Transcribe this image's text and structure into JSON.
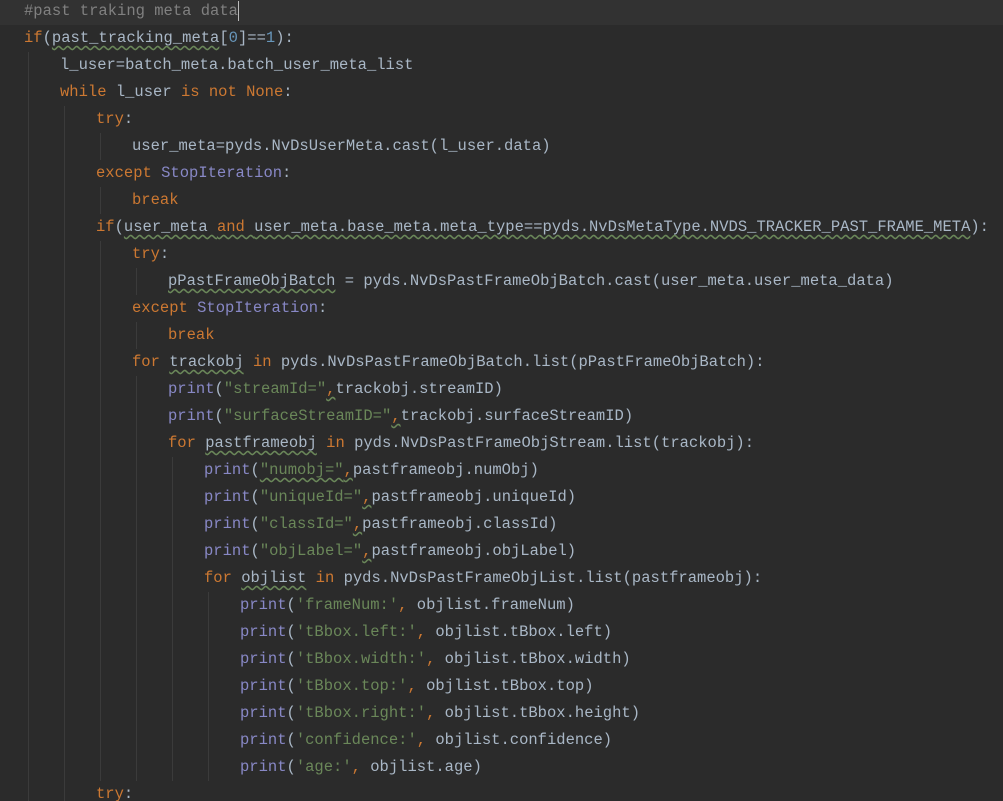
{
  "editor": {
    "theme": {
      "background": "#2b2b2b",
      "current_line": "#323232",
      "keyword": "#cc7832",
      "identifier": "#a9b7c6",
      "number": "#6897bb",
      "string": "#6a8759",
      "comment": "#808080",
      "builtin": "#8888c6"
    },
    "lines": [
      {
        "indent": 0,
        "current": true,
        "tokens": [
          {
            "t": "#past traking meta data",
            "c": "cm"
          }
        ]
      },
      {
        "indent": 0,
        "tokens": [
          {
            "t": "if",
            "c": "kw"
          },
          {
            "t": "(",
            "c": "op"
          },
          {
            "t": "past_tracking_meta",
            "c": "id",
            "sq": true
          },
          {
            "t": "[",
            "c": "op"
          },
          {
            "t": "0",
            "c": "num"
          },
          {
            "t": "]==",
            "c": "op"
          },
          {
            "t": "1",
            "c": "num"
          },
          {
            "t": "):",
            "c": "op"
          }
        ]
      },
      {
        "indent": 1,
        "tokens": [
          {
            "t": "l_user=batch_meta.batch_user_meta_list",
            "c": "id"
          }
        ]
      },
      {
        "indent": 1,
        "tokens": [
          {
            "t": "while ",
            "c": "kw"
          },
          {
            "t": "l_user ",
            "c": "id"
          },
          {
            "t": "is not ",
            "c": "kw"
          },
          {
            "t": "None",
            "c": "kw"
          },
          {
            "t": ":",
            "c": "op"
          }
        ]
      },
      {
        "indent": 2,
        "tokens": [
          {
            "t": "try",
            "c": "kw"
          },
          {
            "t": ":",
            "c": "op"
          }
        ]
      },
      {
        "indent": 3,
        "tokens": [
          {
            "t": "user_meta=pyds.NvDsUserMeta.cast(l_user.data)",
            "c": "id"
          }
        ]
      },
      {
        "indent": 2,
        "tokens": [
          {
            "t": "except ",
            "c": "kw"
          },
          {
            "t": "StopIteration",
            "c": "cls"
          },
          {
            "t": ":",
            "c": "op"
          }
        ]
      },
      {
        "indent": 3,
        "tokens": [
          {
            "t": "break",
            "c": "kw"
          }
        ]
      },
      {
        "indent": 2,
        "tokens": [
          {
            "t": "if",
            "c": "kw"
          },
          {
            "t": "(",
            "c": "op"
          },
          {
            "t": "user_meta ",
            "c": "id",
            "sq": true
          },
          {
            "t": "and ",
            "c": "kw",
            "sq": true
          },
          {
            "t": "user_meta.base_meta.meta_type==pyds.NvDsMetaType.NVDS_TRACKER_PAST_FRAME_META",
            "c": "id",
            "sq": true
          },
          {
            "t": "):",
            "c": "op"
          }
        ]
      },
      {
        "indent": 3,
        "tokens": [
          {
            "t": "try",
            "c": "kw"
          },
          {
            "t": ":",
            "c": "op"
          }
        ]
      },
      {
        "indent": 4,
        "tokens": [
          {
            "t": "pPastFrameObjBatch",
            "c": "id",
            "sq": true
          },
          {
            "t": " = pyds.NvDsPastFrameObjBatch.cast(user_meta.user_meta_data)",
            "c": "id"
          }
        ]
      },
      {
        "indent": 3,
        "tokens": [
          {
            "t": "except ",
            "c": "kw"
          },
          {
            "t": "StopIteration",
            "c": "cls"
          },
          {
            "t": ":",
            "c": "op"
          }
        ]
      },
      {
        "indent": 4,
        "tokens": [
          {
            "t": "break",
            "c": "kw"
          }
        ]
      },
      {
        "indent": 3,
        "tokens": [
          {
            "t": "for ",
            "c": "kw"
          },
          {
            "t": "trackobj",
            "c": "id",
            "sq": true
          },
          {
            "t": " in ",
            "c": "kw"
          },
          {
            "t": "pyds.NvDsPastFrameObjBatch.list(pPastFrameObjBatch):",
            "c": "id"
          }
        ]
      },
      {
        "indent": 4,
        "tokens": [
          {
            "t": "print",
            "c": "cls"
          },
          {
            "t": "(",
            "c": "op"
          },
          {
            "t": "\"streamId=\"",
            "c": "str"
          },
          {
            "t": ",",
            "c": "kw",
            "sq": true
          },
          {
            "t": "trackobj.streamID)",
            "c": "id"
          }
        ]
      },
      {
        "indent": 4,
        "tokens": [
          {
            "t": "print",
            "c": "cls"
          },
          {
            "t": "(",
            "c": "op"
          },
          {
            "t": "\"surfaceStreamID=\"",
            "c": "str"
          },
          {
            "t": ",",
            "c": "kw",
            "sq": true
          },
          {
            "t": "trackobj.surfaceStreamID)",
            "c": "id"
          }
        ]
      },
      {
        "indent": 4,
        "tokens": [
          {
            "t": "for ",
            "c": "kw"
          },
          {
            "t": "pastframeobj",
            "c": "id",
            "sq": true
          },
          {
            "t": " in ",
            "c": "kw"
          },
          {
            "t": "pyds.NvDsPastFrameObjStream.list(trackobj):",
            "c": "id"
          }
        ]
      },
      {
        "indent": 5,
        "tokens": [
          {
            "t": "print",
            "c": "cls"
          },
          {
            "t": "(",
            "c": "op"
          },
          {
            "t": "\"numobj=\"",
            "c": "str",
            "sq": true
          },
          {
            "t": ",",
            "c": "kw",
            "sq": true
          },
          {
            "t": "pastframeobj.numObj)",
            "c": "id"
          }
        ]
      },
      {
        "indent": 5,
        "tokens": [
          {
            "t": "print",
            "c": "cls"
          },
          {
            "t": "(",
            "c": "op"
          },
          {
            "t": "\"uniqueId=\"",
            "c": "str"
          },
          {
            "t": ",",
            "c": "kw",
            "sq": true
          },
          {
            "t": "pastframeobj.uniqueId)",
            "c": "id"
          }
        ]
      },
      {
        "indent": 5,
        "tokens": [
          {
            "t": "print",
            "c": "cls"
          },
          {
            "t": "(",
            "c": "op"
          },
          {
            "t": "\"classId=\"",
            "c": "str"
          },
          {
            "t": ",",
            "c": "kw",
            "sq": true
          },
          {
            "t": "pastframeobj.classId)",
            "c": "id"
          }
        ]
      },
      {
        "indent": 5,
        "tokens": [
          {
            "t": "print",
            "c": "cls"
          },
          {
            "t": "(",
            "c": "op"
          },
          {
            "t": "\"objLabel=\"",
            "c": "str"
          },
          {
            "t": ",",
            "c": "kw",
            "sq": true
          },
          {
            "t": "pastframeobj.objLabel)",
            "c": "id"
          }
        ]
      },
      {
        "indent": 5,
        "tokens": [
          {
            "t": "for ",
            "c": "kw"
          },
          {
            "t": "objlist",
            "c": "id",
            "sq": true
          },
          {
            "t": " in ",
            "c": "kw"
          },
          {
            "t": "pyds.NvDsPastFrameObjList.list(pastframeobj):",
            "c": "id"
          }
        ]
      },
      {
        "indent": 6,
        "tokens": [
          {
            "t": "print",
            "c": "cls"
          },
          {
            "t": "(",
            "c": "op"
          },
          {
            "t": "'frameNum:'",
            "c": "str"
          },
          {
            "t": ", ",
            "c": "kw"
          },
          {
            "t": "objlist.frameNum)",
            "c": "id"
          }
        ]
      },
      {
        "indent": 6,
        "tokens": [
          {
            "t": "print",
            "c": "cls"
          },
          {
            "t": "(",
            "c": "op"
          },
          {
            "t": "'tBbox.left:'",
            "c": "str"
          },
          {
            "t": ", ",
            "c": "kw"
          },
          {
            "t": "objlist.tBbox.left)",
            "c": "id"
          }
        ]
      },
      {
        "indent": 6,
        "tokens": [
          {
            "t": "print",
            "c": "cls"
          },
          {
            "t": "(",
            "c": "op"
          },
          {
            "t": "'tBbox.width:'",
            "c": "str"
          },
          {
            "t": ", ",
            "c": "kw"
          },
          {
            "t": "objlist.tBbox.width)",
            "c": "id"
          }
        ]
      },
      {
        "indent": 6,
        "tokens": [
          {
            "t": "print",
            "c": "cls"
          },
          {
            "t": "(",
            "c": "op"
          },
          {
            "t": "'tBbox.top:'",
            "c": "str"
          },
          {
            "t": ", ",
            "c": "kw"
          },
          {
            "t": "objlist.tBbox.top)",
            "c": "id"
          }
        ]
      },
      {
        "indent": 6,
        "tokens": [
          {
            "t": "print",
            "c": "cls"
          },
          {
            "t": "(",
            "c": "op"
          },
          {
            "t": "'tBbox.right:'",
            "c": "str"
          },
          {
            "t": ", ",
            "c": "kw"
          },
          {
            "t": "objlist.tBbox.height)",
            "c": "id"
          }
        ]
      },
      {
        "indent": 6,
        "tokens": [
          {
            "t": "print",
            "c": "cls"
          },
          {
            "t": "(",
            "c": "op"
          },
          {
            "t": "'confidence:'",
            "c": "str"
          },
          {
            "t": ", ",
            "c": "kw"
          },
          {
            "t": "objlist.confidence)",
            "c": "id"
          }
        ]
      },
      {
        "indent": 6,
        "tokens": [
          {
            "t": "print",
            "c": "cls"
          },
          {
            "t": "(",
            "c": "op"
          },
          {
            "t": "'age:'",
            "c": "str"
          },
          {
            "t": ", ",
            "c": "kw"
          },
          {
            "t": "objlist.age)",
            "c": "id"
          }
        ]
      },
      {
        "indent": 2,
        "tokens": [
          {
            "t": "try",
            "c": "kw"
          },
          {
            "t": ":",
            "c": "op"
          }
        ]
      }
    ]
  }
}
